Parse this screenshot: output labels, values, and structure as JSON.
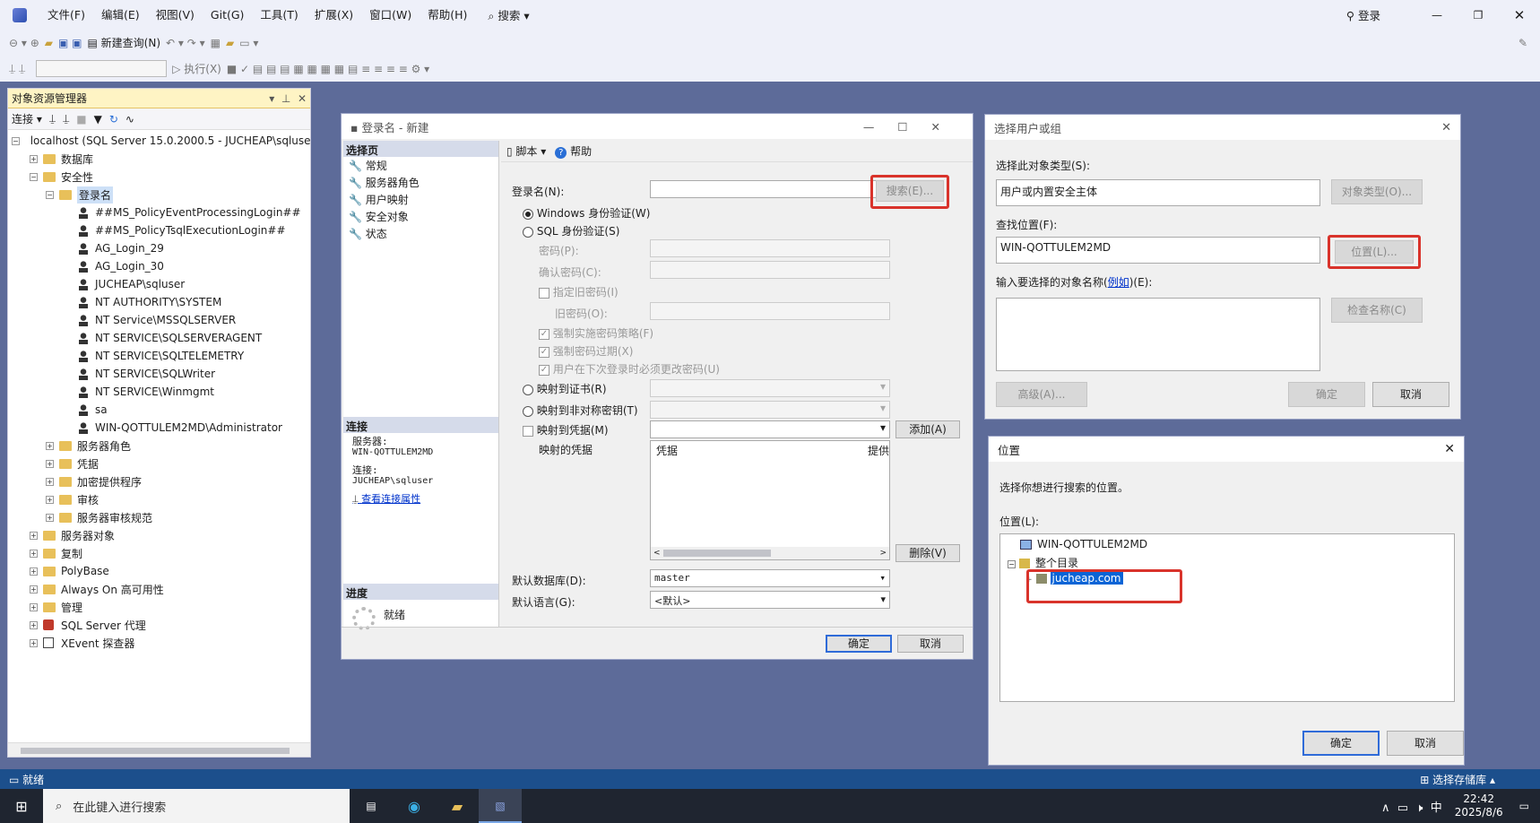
{
  "app": {
    "menus": [
      "文件(F)",
      "编辑(E)",
      "视图(V)",
      "Git(G)",
      "工具(T)",
      "扩展(X)",
      "窗口(W)",
      "帮助(H)"
    ],
    "search": "搜索",
    "login": "登录"
  },
  "toolbar": {
    "new_query": "新建查询(N)",
    "execute": "执行(X)"
  },
  "oe": {
    "title": "对象资源管理器",
    "connect": "连接",
    "server": "localhost (SQL Server 15.0.2000.5 - JUCHEAP\\sqluse",
    "nodes": {
      "databases": "数据库",
      "security": "安全性",
      "logins": "登录名",
      "logins_list": [
        "##MS_PolicyEventProcessingLogin##",
        "##MS_PolicyTsqlExecutionLogin##",
        "AG_Login_29",
        "AG_Login_30",
        "JUCHEAP\\sqluser",
        "NT AUTHORITY\\SYSTEM",
        "NT Service\\MSSQLSERVER",
        "NT SERVICE\\SQLSERVERAGENT",
        "NT SERVICE\\SQLTELEMETRY",
        "NT SERVICE\\SQLWriter",
        "NT SERVICE\\Winmgmt",
        "sa",
        "WIN-QOTTULEM2MD\\Administrator"
      ],
      "security_children": [
        "服务器角色",
        "凭据",
        "加密提供程序",
        "审核",
        "服务器审核规范"
      ],
      "top_level": [
        "服务器对象",
        "复制",
        "PolyBase",
        "Always On 高可用性",
        "管理",
        "SQL Server 代理",
        "XEvent 探查器"
      ]
    }
  },
  "login_dlg": {
    "title": "登录名 - 新建",
    "select_page": "选择页",
    "pages": [
      "常规",
      "服务器角色",
      "用户映射",
      "安全对象",
      "状态"
    ],
    "script": "脚本",
    "help": "帮助",
    "login_name": "登录名(N):",
    "search_btn": "搜索(E)...",
    "win_auth": "Windows 身份验证(W)",
    "sql_auth": "SQL 身份验证(S)",
    "password": "密码(P):",
    "confirm_pw": "确认密码(C):",
    "specify_old": "指定旧密码(I)",
    "old_pw": "旧密码(O):",
    "enforce_policy": "强制实施密码策略(F)",
    "enforce_exp": "强制密码过期(X)",
    "must_change": "用户在下次登录时必须更改密码(U)",
    "map_cert": "映射到证书(R)",
    "map_asym": "映射到非对称密钥(T)",
    "map_cred": "映射到凭据(M)",
    "add_btn": "添加(A)",
    "mapped_cred": "映射的凭据",
    "col_cred": "凭据",
    "col_provider": "提供",
    "remove_btn": "删除(V)",
    "default_db": "默认数据库(D):",
    "default_db_val": "master",
    "default_lang": "默认语言(G):",
    "default_lang_val": "<默认>",
    "conn_header": "连接",
    "server_lbl": "服务器:",
    "server_val": "WIN-QOTTULEM2MD",
    "conn_lbl": "连接:",
    "conn_val": "JUCHEAP\\sqluser",
    "view_props": "查看连接属性",
    "progress_header": "进度",
    "ready": "就绪",
    "ok": "确定",
    "cancel": "取消"
  },
  "select_dlg": {
    "title": "选择用户或组",
    "obj_type_lbl": "选择此对象类型(S):",
    "obj_type_val": "用户或内置安全主体",
    "obj_type_btn": "对象类型(O)...",
    "loc_lbl": "查找位置(F):",
    "loc_val": "WIN-QOTTULEM2MD",
    "loc_btn": "位置(L)...",
    "enter_lbl_a": "输入要选择的对象名称(",
    "enter_link": "例如",
    "enter_lbl_b": ")(E):",
    "check_btn": "检查名称(C)",
    "advanced": "高级(A)...",
    "ok": "确定",
    "cancel": "取消"
  },
  "loc_dlg": {
    "title": "位置",
    "desc": "选择你想进行搜索的位置。",
    "loc_lbl": "位置(L):",
    "tree": [
      "WIN-QOTTULEM2MD",
      "整个目录",
      "jucheap.com"
    ],
    "ok": "确定",
    "cancel": "取消"
  },
  "status": {
    "ready": "就绪",
    "repo": "选择存储库"
  },
  "taskbar": {
    "search": "在此键入进行搜索",
    "time": "22:42",
    "date": "2025/8/6",
    "ime": "中"
  }
}
